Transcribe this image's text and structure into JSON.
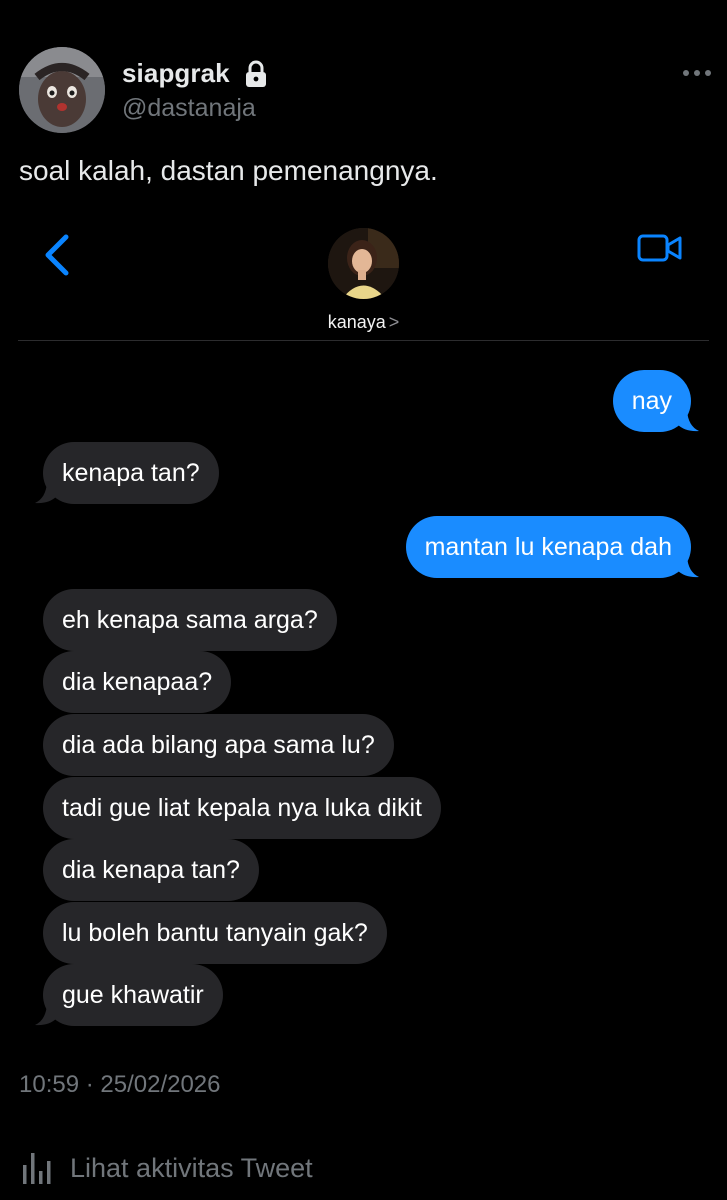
{
  "tweet": {
    "display_name": "siapgrak",
    "handle": "@dastanaja",
    "text": "soal kalah, dastan pemenangnya.",
    "timestamp": "10:59 · 25/02/2026",
    "analytics_label": "Lihat aktivitas Tweet"
  },
  "chat": {
    "contact_name": "kanaya",
    "contact_chevron": ">",
    "messages": [
      {
        "from": "me",
        "text": "nay"
      },
      {
        "from": "them",
        "text": "kenapa tan?"
      },
      {
        "from": "me",
        "text": "mantan lu kenapa dah"
      },
      {
        "from": "them",
        "text": "eh kenapa sama arga?"
      },
      {
        "from": "them",
        "text": "dia kenapaa?"
      },
      {
        "from": "them",
        "text": "dia ada bilang apa sama lu?"
      },
      {
        "from": "them",
        "text": "tadi gue liat kepala nya luka dikit"
      },
      {
        "from": "them",
        "text": "dia kenapa tan?"
      },
      {
        "from": "them",
        "text": "lu boleh bantu tanyain gak?"
      },
      {
        "from": "them",
        "text": "gue khawatir"
      }
    ]
  },
  "icons": {
    "lock": "lock-icon",
    "more": "more-horizontal-icon",
    "back": "chevron-left-icon",
    "video": "video-camera-icon",
    "analytics": "bar-chart-icon"
  },
  "colors": {
    "background": "#000000",
    "outgoing_bubble": "#1a8cff",
    "incoming_bubble": "#262629",
    "ios_accent": "#0a84ff",
    "secondary_text": "#71767b"
  }
}
